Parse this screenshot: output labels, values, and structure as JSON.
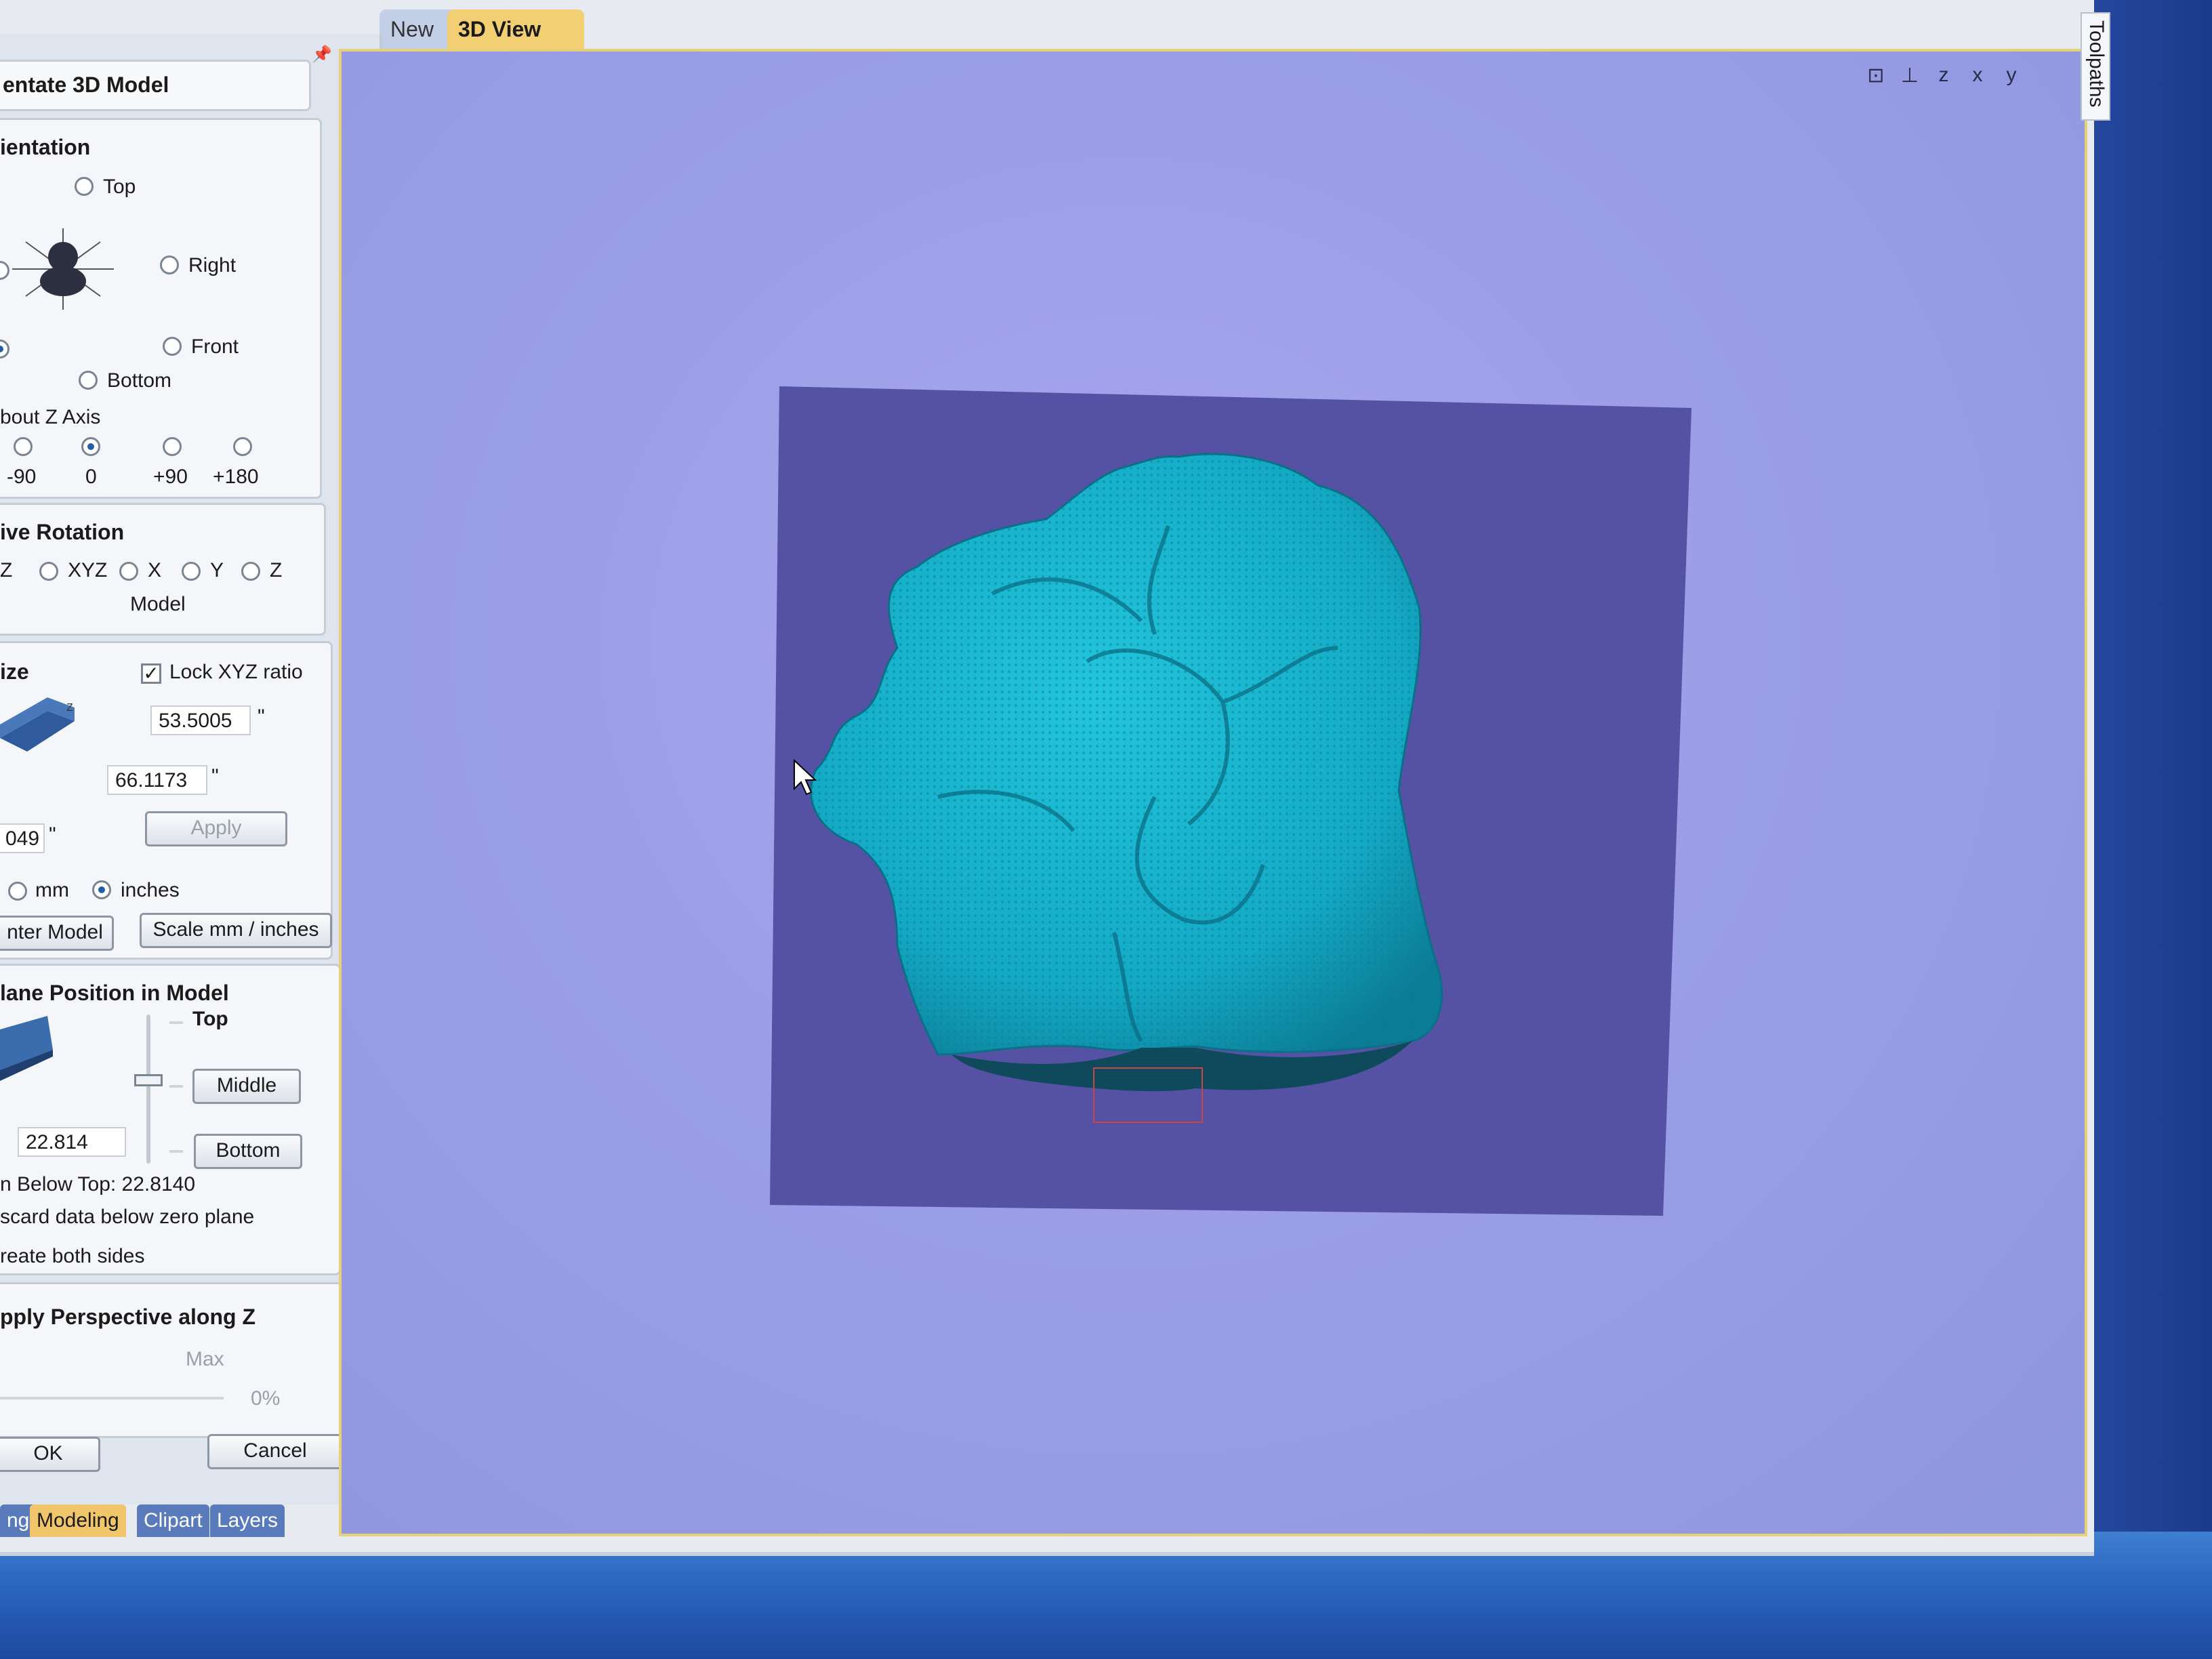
{
  "tabs": {
    "new": "New",
    "view3d": "3D View"
  },
  "toolpaths": "Toolpaths",
  "panel": {
    "title": "entate 3D Model",
    "orientation": {
      "title": "ientation",
      "top": "Top",
      "right": "Right",
      "front": "Front",
      "bottom": "Bottom",
      "about_z": "bout Z Axis",
      "z_values": [
        "-90",
        "0",
        "+90",
        "+180"
      ],
      "z_selected": "0"
    },
    "rotation": {
      "title": "ive Rotation",
      "prefix": "Z",
      "options": [
        "XYZ",
        "X",
        "Y",
        "Z"
      ],
      "model": "Model"
    },
    "size": {
      "title": "ize",
      "lock": "Lock XYZ ratio",
      "lock_checked": true,
      "val1": "53.5005",
      "val2": "66.1173",
      "val3": "049",
      "unit_mark": "\"",
      "apply": "Apply",
      "mm": "mm",
      "inches": "inches",
      "units_selected": "inches",
      "center": "nter Model",
      "scale": "Scale mm / inches"
    },
    "plane": {
      "title": "lane Position in Model",
      "top": "Top",
      "middle": "Middle",
      "bottom": "Bottom",
      "value": "22.814",
      "below_top": "n Below Top:  22.8140",
      "discard": "scard data below zero plane",
      "both": "reate both sides"
    },
    "perspective": {
      "title": "pply Perspective along Z",
      "max": "Max",
      "pct": "0%"
    },
    "ok": "OK",
    "cancel": "Cancel"
  },
  "bottom_tabs": [
    "ng",
    "Modeling",
    "Clipart",
    "Layers"
  ],
  "bottom_tab_active": "Modeling",
  "view_icons": [
    "fit-icon",
    "iso-icon",
    "z-icon",
    "x-icon",
    "y-icon"
  ],
  "colors": {
    "viewport": "#9b9ee6",
    "model": "#17b3cc",
    "tile": "#5552a5"
  }
}
